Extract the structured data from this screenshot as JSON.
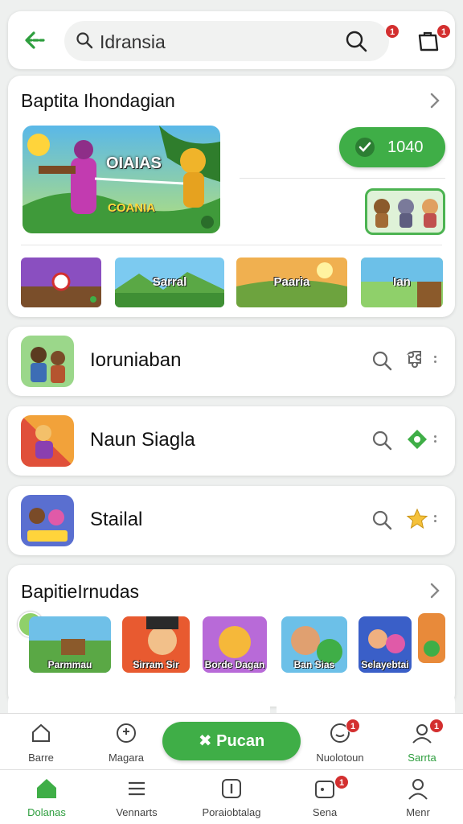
{
  "search": {
    "text": "Idransia",
    "badge": "1"
  },
  "bag": {
    "badge": "1"
  },
  "featured": {
    "title": "Baptita Ihondagian",
    "hero_title": "OIAIAS",
    "hero_subtitle": "COANIA",
    "points": "1040",
    "thumbs": [
      {
        "label": ""
      },
      {
        "label": "Sarral"
      },
      {
        "label": "Paaria"
      },
      {
        "label": "Ian"
      }
    ]
  },
  "rows": [
    {
      "name": "Ioruniaban",
      "action_icon": "puzzle-icon"
    },
    {
      "name": "Naun Siagla",
      "action_icon": "gem-icon"
    },
    {
      "name": "Stailal",
      "action_icon": "star-icon"
    }
  ],
  "recommended": {
    "title": "BapitieIrnudas",
    "items": [
      {
        "label": "Parmmau"
      },
      {
        "label": "Sirram Sir"
      },
      {
        "label": "Borde Dagan"
      },
      {
        "label": "Ban Sias"
      },
      {
        "label": "Selayebtai"
      }
    ]
  },
  "actionbar": {
    "items": [
      {
        "label": "Barre"
      },
      {
        "label": "Magara"
      },
      {
        "label": "Nuolotoun",
        "badge": "1"
      },
      {
        "label": "Sarrta",
        "badge": "1"
      }
    ],
    "primary": "✖ Pucan"
  },
  "navbar": {
    "items": [
      {
        "label": "Dolanas",
        "active": true
      },
      {
        "label": "Vennarts"
      },
      {
        "label": "Poraiobtalag"
      },
      {
        "label": "Sena",
        "badge": "1"
      },
      {
        "label": "Menr"
      }
    ]
  },
  "colors": {
    "accent": "#3fae47",
    "badge": "#d32f2f",
    "background": "#eef0ef"
  }
}
